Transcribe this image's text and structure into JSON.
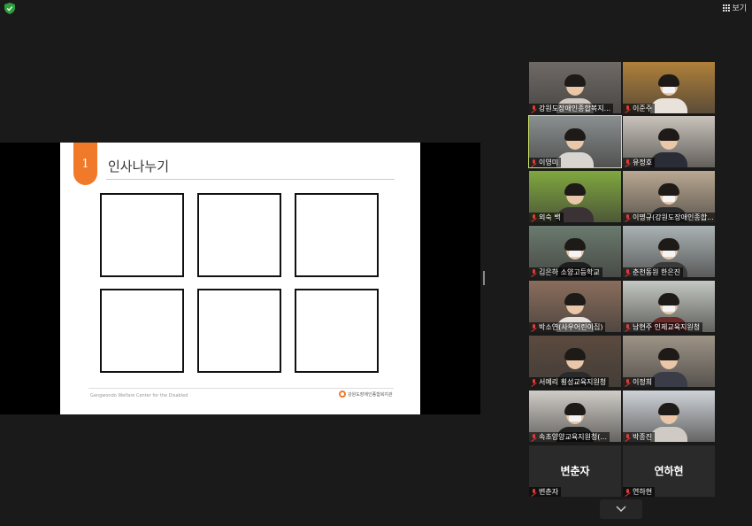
{
  "top_bar": {
    "view_label": "보기"
  },
  "slide": {
    "number": "1",
    "title": "인사나누기",
    "footer_left": "Gangwondo Welfare Center for the Disabled",
    "footer_logo_text": "강원도장애인종합복지관"
  },
  "participants": [
    {
      "name": "강원도장애인종합복지...",
      "type": "video",
      "bg": "#6f6a66",
      "shirt": "#d0c8c0",
      "mask": false
    },
    {
      "name": "이준주",
      "type": "video",
      "bg": "#b0803a",
      "shirt": "#e8e2da",
      "mask": true
    },
    {
      "name": "이영미",
      "type": "video",
      "bg": "#8a8f90",
      "shirt": "#d8d4d0",
      "mask": false,
      "active": true
    },
    {
      "name": "유정호",
      "type": "video",
      "bg": "#c9c3bb",
      "shirt": "#2a2d36",
      "mask": false
    },
    {
      "name": "외숙 백",
      "type": "video",
      "bg": "#7fa83e",
      "shirt": "#3a3234",
      "mask": false
    },
    {
      "name": "이명규(강원도장애인종합...",
      "type": "video",
      "bg": "#b9a892",
      "shirt": "#2c2c2c",
      "mask": true
    },
    {
      "name": "김은하 소양고등학교",
      "type": "video",
      "bg": "#6a7a6e",
      "shirt": "#1e1e1e",
      "mask": true
    },
    {
      "name": "춘천동원 한은진",
      "type": "video",
      "bg": "#aab2b4",
      "shirt": "#3a3a3a",
      "mask": true
    },
    {
      "name": "박소연(사우어린이집)",
      "type": "video",
      "bg": "#8a6d5c",
      "shirt": "#e6e2dc",
      "mask": false
    },
    {
      "name": "남현주 인제교육지원청",
      "type": "video",
      "bg": "#c3c8c2",
      "shirt": "#6b2b2b",
      "mask": true
    },
    {
      "name": "서예리 횡성교육지원청",
      "type": "video",
      "bg": "#5b4a3e",
      "shirt": "#2a2a2a",
      "mask": false
    },
    {
      "name": "이정희",
      "type": "video",
      "bg": "#9e9488",
      "shirt": "#3a3d48",
      "mask": false
    },
    {
      "name": "속초양양교육지원청(...",
      "type": "video",
      "bg": "#d0cdc8",
      "shirt": "#1f1f1f",
      "mask": true
    },
    {
      "name": "박종진",
      "type": "video",
      "bg": "#cfd3d8",
      "shirt": "#cfcac4",
      "mask": false
    },
    {
      "name": "변춘자",
      "type": "name_only",
      "display": "변춘자"
    },
    {
      "name": "연하현",
      "type": "name_only",
      "display": "연하현"
    }
  ],
  "colors": {
    "active_outline": "#c9e265",
    "accent": "#f07a2a",
    "muted_mic": "#e53935"
  },
  "icons": [
    "shield-icon",
    "grid-icon",
    "mic-muted-icon",
    "chevron-down-icon"
  ]
}
